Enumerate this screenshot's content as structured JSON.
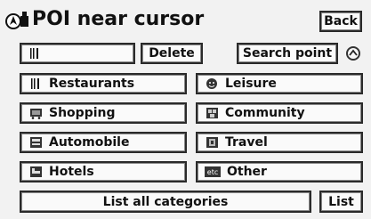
{
  "header": {
    "title": "POI near cursor",
    "back_label": "Back"
  },
  "toolbar": {
    "delete_label": "Delete",
    "search_point_label": "Search point"
  },
  "categories": [
    {
      "label": "Restaurants",
      "icon": "fork-knife-icon"
    },
    {
      "label": "Leisure",
      "icon": "leisure-icon"
    },
    {
      "label": "Shopping",
      "icon": "shopping-cart-icon"
    },
    {
      "label": "Community",
      "icon": "community-icon"
    },
    {
      "label": "Automobile",
      "icon": "car-icon"
    },
    {
      "label": "Travel",
      "icon": "travel-icon"
    },
    {
      "label": "Hotels",
      "icon": "hotel-bed-icon"
    },
    {
      "label": "Other",
      "icon": "etc-icon"
    }
  ],
  "footer": {
    "list_all_label": "List all categories",
    "list_label": "List"
  },
  "other_icon_text": "etc"
}
